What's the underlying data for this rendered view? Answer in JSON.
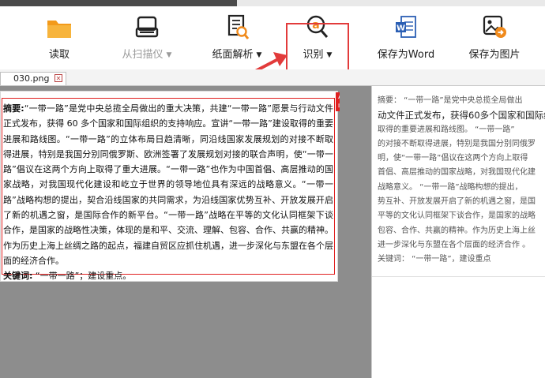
{
  "toolbar": {
    "read_label": "读取",
    "scan_label": "从扫描仪",
    "parse_label": "纸面解析",
    "recognize_label": "识别",
    "word_label": "保存为Word",
    "image_label": "保存为图片"
  },
  "tab": {
    "filename": "030.png"
  },
  "left_page": {
    "paragraph_label": "摘要:",
    "paragraph": "“一带一路”是党中央总揽全局做出的重大决策，共建“一带一路”愿景与行动文件正式发布，获得 60 多个国家和国际组织的支持响应。宣讲“一带一路”建设取得的重要进展和路线图。“一带一路”的立体布局日趋清晰，同沿线国家发展规划的对接不断取得进展，特别是我国分别同俄罗斯、欧洲签署了发展规划对接的联合声明，使“一带一路”倡议在这两个方向上取得了重大进展。“一带一路”也作为中国首倡、高层推动的国家战略，对我国现代化建设和屹立于世界的领导地位具有深远的战略意义。“一带一路”战略构想的提出，契合沿线国家的共同需求，为沿线国家优势互补、开放发展开启了新的机遇之窗，是国际合作的新平台。“一带一路”战略在平等的文化认同框架下谈合作，是国家的战略性决策，体现的是和平、交流、理解、包容、合作、共赢的精神。作为历史上海上丝绸之路的起点，福建自贸区应抓住机遇，进一步深化与东盟在各个层面的经济合作。",
    "keywords_label": "关键词:",
    "keywords": "“一带一路”；建设重点。"
  },
  "right_page": {
    "lines": [
      "摘要：  “一带一路”是党中央总揽全局做出",
      "动文件正式发布，获得60多个国家和国际组",
      "取得的重要进展和路线图。  “一带一路”",
      "的对接不断取得进展，特别是我国分别同俄罗",
      "明，使“一带一路”倡议在这两个方向上取得",
      "首倡、高层推动的国家战略，对我国现代化建",
      "战略意义。  “一带一路”战略构想的提出，",
      "势互补、开放发展开启了新的机遇之窗，是国",
      "平等的文化认同框架下谈合作，是国家的战略",
      "包容、合作、共赢的精神。作为历史上海上丝",
      "进一步深化与东盟在各个层面的经济合作 。",
      "关键词：  “一带一路”，建设重点"
    ]
  },
  "colors": {
    "highlight": "#e23b3b",
    "selection": "#e02020",
    "folder": "#f39a1a",
    "word_blue": "#2b5fb4",
    "search_orange": "#f08a1c"
  },
  "icons": [
    "folder-icon",
    "scanner-icon",
    "document-search-icon",
    "ocr-search-icon",
    "word-icon",
    "image-save-icon",
    "close-icon",
    "text-marker-icon",
    "arrow-annotation"
  ]
}
